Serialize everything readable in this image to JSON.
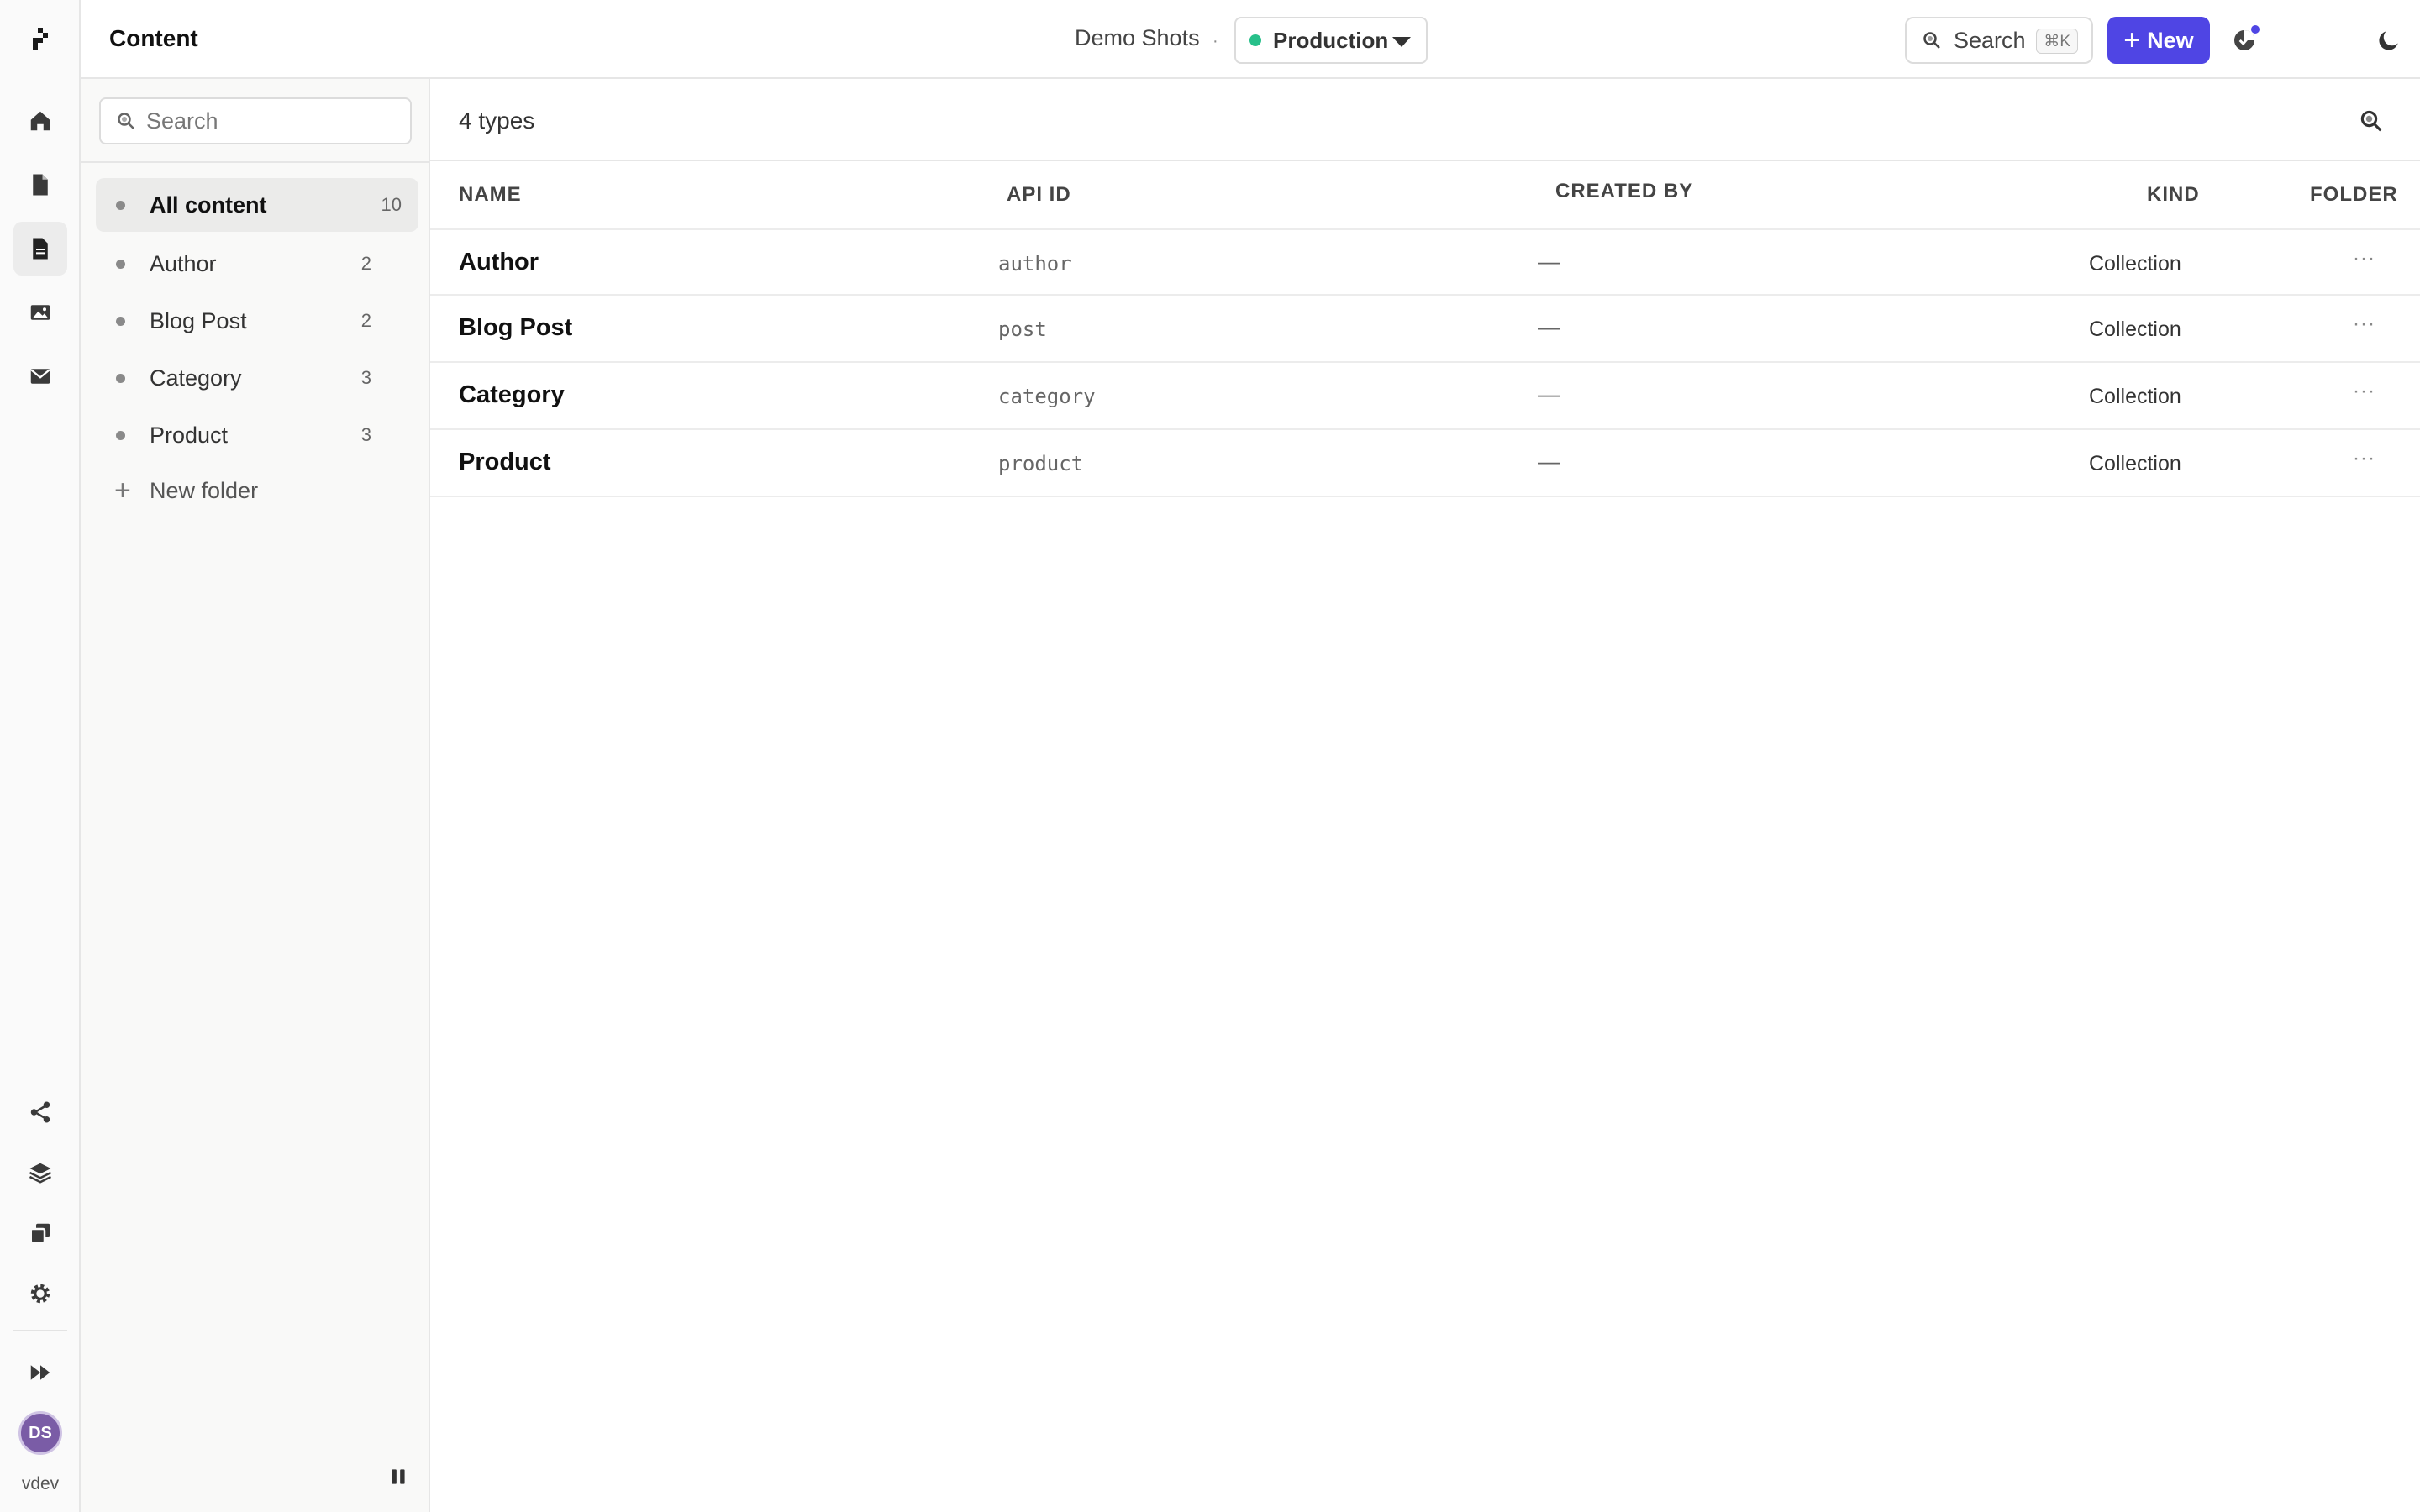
{
  "app": {
    "title": "Content",
    "workspace": "Demo Shots",
    "separator": "·",
    "environment": "Production",
    "environment_color": "#27c08a",
    "accent_color": "#4f45e4"
  },
  "topbar": {
    "search_label": "Search",
    "search_shortcut": "⌘K",
    "new_label": "New",
    "new_icon": "plus-icon",
    "notifications_icon": "notifications-icon",
    "theme_icon": "moon-icon",
    "help_label": "?"
  },
  "rail": {
    "items": [
      {
        "icon": "home-icon"
      },
      {
        "icon": "document-icon"
      },
      {
        "icon": "content-icon",
        "active": true
      },
      {
        "icon": "image-icon"
      },
      {
        "icon": "mail-icon"
      }
    ],
    "bottom_items": [
      {
        "icon": "share-icon"
      },
      {
        "icon": "layers-icon"
      },
      {
        "icon": "copy-icon"
      },
      {
        "icon": "gear-icon"
      },
      {
        "icon": "fast-forward-icon"
      }
    ],
    "avatar_initials": "DS",
    "user": "vdev"
  },
  "sidebar": {
    "search_placeholder": "Search",
    "folders": [
      {
        "label": "All content",
        "count": "10",
        "active": true
      },
      {
        "label": "Author",
        "count": "2"
      },
      {
        "label": "Blog Post",
        "count": "2"
      },
      {
        "label": "Category",
        "count": "3"
      },
      {
        "label": "Product",
        "count": "3"
      }
    ],
    "new_folder_label": "New folder"
  },
  "main": {
    "types_count": "4 types",
    "columns": {
      "name": "NAME",
      "api_id": "API ID",
      "created_by": "CREATED BY",
      "kind": "KIND",
      "folder": "FOLDER"
    },
    "rows": [
      {
        "name": "Author",
        "api_id": "author",
        "created_by": "—",
        "kind": "Collection",
        "more": "···"
      },
      {
        "name": "Blog Post",
        "api_id": "post",
        "created_by": "—",
        "kind": "Collection",
        "more": "···"
      },
      {
        "name": "Category",
        "api_id": "category",
        "created_by": "—",
        "kind": "Collection",
        "more": "···"
      },
      {
        "name": "Product",
        "api_id": "product",
        "created_by": "—",
        "kind": "Collection",
        "more": "···"
      }
    ]
  }
}
